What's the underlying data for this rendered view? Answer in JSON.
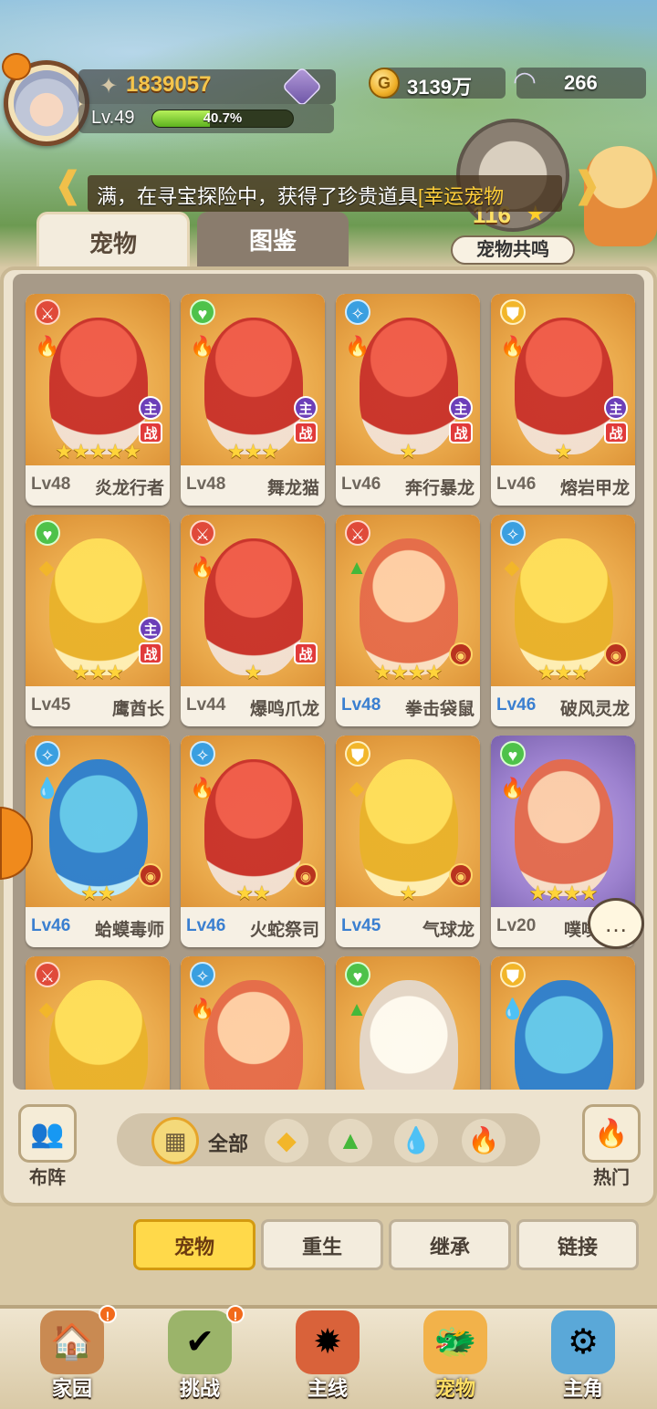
{
  "player": {
    "power": "1839057",
    "level": "Lv.49",
    "exp_percent": "40.7%",
    "exp_fraction": 0.407
  },
  "currencies": {
    "gold": "3139万",
    "shell": "266"
  },
  "notice": {
    "prefix": "满，在寻宝探险中，获得了珍贵道具",
    "highlight": "[幸运宠物"
  },
  "resonance": {
    "count": "116",
    "label": "宠物共鸣"
  },
  "tabs": [
    {
      "label": "宠物"
    },
    {
      "label": "图鉴"
    }
  ],
  "pets": [
    {
      "level": "Lv48",
      "name": "炎龙行者",
      "stars": "★★★★★",
      "main": "主",
      "battle": "战"
    },
    {
      "level": "Lv48",
      "name": "舞龙猫",
      "stars": "★★★",
      "main": "主",
      "battle": "战"
    },
    {
      "level": "Lv46",
      "name": "奔行暴龙",
      "stars": "★",
      "main": "主",
      "battle": "战"
    },
    {
      "level": "Lv46",
      "name": "熔岩甲龙",
      "stars": "★",
      "main": "主",
      "battle": "战"
    },
    {
      "level": "Lv45",
      "name": "鹰酋长",
      "stars": "★★★",
      "main": "主",
      "battle": "战"
    },
    {
      "level": "Lv44",
      "name": "爆鸣爪龙",
      "stars": "★",
      "battle": "战"
    },
    {
      "level": "Lv48",
      "name": "拳击袋鼠",
      "stars": "★★★★"
    },
    {
      "level": "Lv46",
      "name": "破风灵龙",
      "stars": "★★★"
    },
    {
      "level": "Lv46",
      "name": "蛤蟆毒师",
      "stars": "★★"
    },
    {
      "level": "Lv46",
      "name": "火蛇祭司",
      "stars": "★★"
    },
    {
      "level": "Lv45",
      "name": "气球龙",
      "stars": "★"
    },
    {
      "level": "Lv20",
      "name": "噗噗",
      "stars": "★★★★"
    },
    {},
    {},
    {},
    {}
  ],
  "filters": {
    "formation_label": "布阵",
    "all_label": "全部",
    "hot_label": "热门"
  },
  "subtabs": [
    {
      "label": "宠物"
    },
    {
      "label": "重生"
    },
    {
      "label": "继承"
    },
    {
      "label": "链接"
    }
  ],
  "bottom_nav": [
    {
      "label": "家园",
      "badge": "!"
    },
    {
      "label": "挑战",
      "badge": "!"
    },
    {
      "label": "主线"
    },
    {
      "label": "宠物"
    },
    {
      "label": "主角"
    }
  ]
}
